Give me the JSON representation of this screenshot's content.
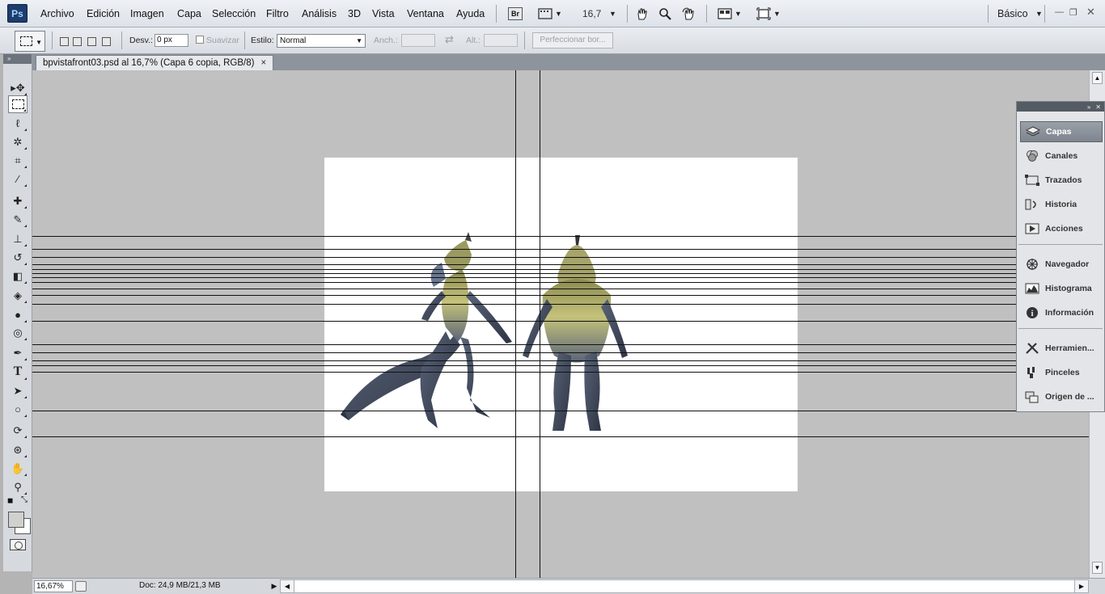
{
  "app": {
    "logo": "Ps",
    "name": "Adobe Photoshop"
  },
  "menu": [
    "Archivo",
    "Edición",
    "Imagen",
    "Capa",
    "Selección",
    "Filtro",
    "Análisis",
    "3D",
    "Vista",
    "Ventana",
    "Ayuda"
  ],
  "appbar": {
    "bridge_label": "Br",
    "zoom": "16,7",
    "workspace": "Básico"
  },
  "options": {
    "feather_label": "Desv.:",
    "feather_value": "0 px",
    "antialias_label": "Suavizar",
    "style_label": "Estilo:",
    "style_value": "Normal",
    "width_label": "Anch.:",
    "height_label": "Alt.:",
    "refine_label": "Perfeccionar bor..."
  },
  "document": {
    "tab_title": "bpvistafront03.psd al 16,7% (Capa 6 copia, RGB/8)",
    "close_glyph": "×"
  },
  "status": {
    "zoom": "16,67%",
    "doc_info": "Doc: 24,9 MB/21,3 MB"
  },
  "tools": [
    {
      "name": "move-tool",
      "glyph": "▸✥"
    },
    {
      "name": "rect-marquee-tool",
      "glyph": ""
    },
    {
      "name": "lasso-tool",
      "glyph": "ℓ"
    },
    {
      "name": "magic-wand-tool",
      "glyph": "✲"
    },
    {
      "name": "crop-tool",
      "glyph": "⌗"
    },
    {
      "name": "eyedropper-tool",
      "glyph": "⁄"
    },
    {
      "name": "healing-brush-tool",
      "glyph": "✚"
    },
    {
      "name": "brush-tool",
      "glyph": "✎"
    },
    {
      "name": "clone-stamp-tool",
      "glyph": "⊥"
    },
    {
      "name": "history-brush-tool",
      "glyph": "↺"
    },
    {
      "name": "eraser-tool",
      "glyph": "◧"
    },
    {
      "name": "paint-bucket-tool",
      "glyph": "◈"
    },
    {
      "name": "blur-tool",
      "glyph": "●"
    },
    {
      "name": "dodge-tool",
      "glyph": "◎"
    },
    {
      "name": "pen-tool",
      "glyph": "✒"
    },
    {
      "name": "type-tool",
      "glyph": "T"
    },
    {
      "name": "path-selection-tool",
      "glyph": "➤"
    },
    {
      "name": "ellipse-shape-tool",
      "glyph": "○"
    },
    {
      "name": "3d-rotate-tool",
      "glyph": "⟳"
    },
    {
      "name": "3d-orbit-tool",
      "glyph": "⊛"
    },
    {
      "name": "hand-tool",
      "glyph": "✋"
    },
    {
      "name": "zoom-tool",
      "glyph": "⚲"
    }
  ],
  "panels": [
    {
      "label": "Capas",
      "icon": "layers-icon",
      "active": true
    },
    {
      "label": "Canales",
      "icon": "channels-icon"
    },
    {
      "label": "Trazados",
      "icon": "paths-icon"
    },
    {
      "label": "Historia",
      "icon": "history-icon"
    },
    {
      "label": "Acciones",
      "icon": "actions-icon"
    },
    {
      "label": "Navegador",
      "icon": "navigator-icon"
    },
    {
      "label": "Histograma",
      "icon": "histogram-icon"
    },
    {
      "label": "Información",
      "icon": "info-icon"
    },
    {
      "label": "Herramien...",
      "icon": "tool-presets-icon"
    },
    {
      "label": "Pinceles",
      "icon": "brushes-icon"
    },
    {
      "label": "Origen de ...",
      "icon": "clone-source-icon"
    }
  ],
  "colors": {
    "menu_bg": "#e4e8ee",
    "canvas_bg": "#c0c0c0",
    "logo_bg": "#1c3d6e",
    "active_panel": "#8a9099"
  }
}
